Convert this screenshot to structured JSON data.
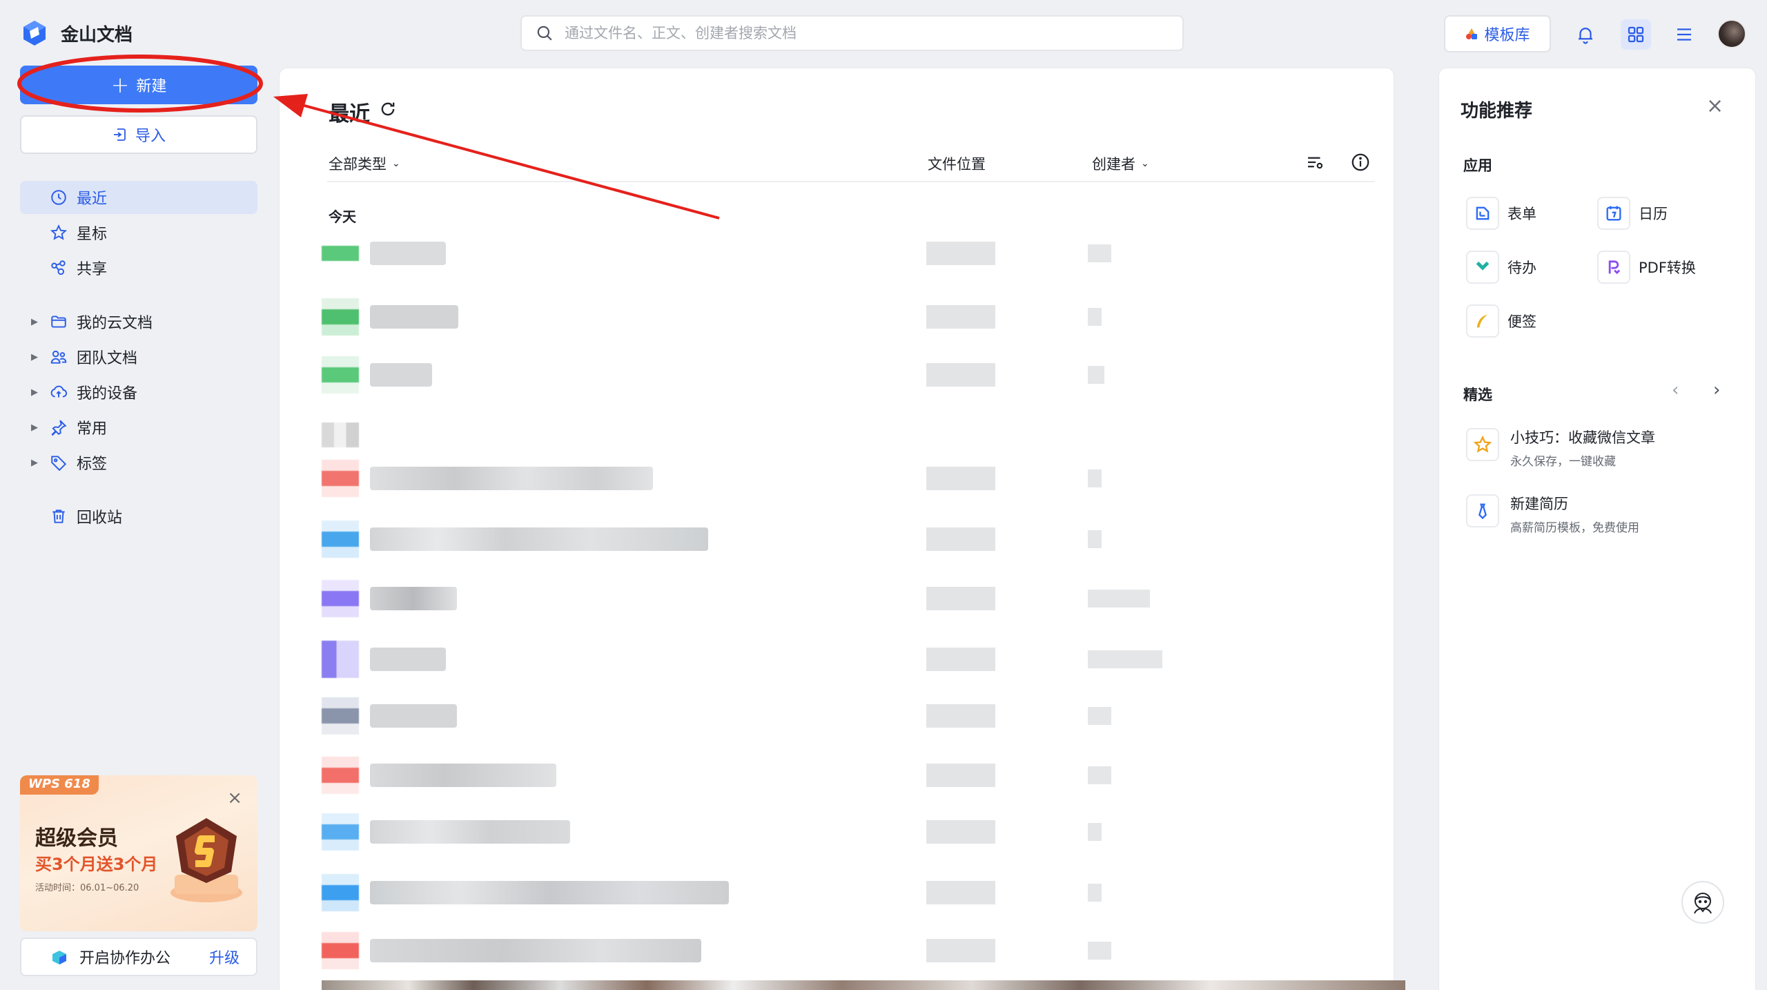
{
  "app": {
    "name": "金山文档"
  },
  "search": {
    "placeholder": "通过文件名、正文、创建者搜索文档"
  },
  "header": {
    "template_label": "模板库"
  },
  "sidebar": {
    "new_label": "新建",
    "import_label": "导入",
    "nav": [
      {
        "label": "最近",
        "icon": "clock-icon",
        "active": true
      },
      {
        "label": "星标",
        "icon": "star-icon"
      },
      {
        "label": "共享",
        "icon": "share-icon"
      }
    ],
    "folders": [
      {
        "label": "我的云文档",
        "icon": "folder-icon"
      },
      {
        "label": "团队文档",
        "icon": "team-icon"
      },
      {
        "label": "我的设备",
        "icon": "cloud-device-icon"
      },
      {
        "label": "常用",
        "icon": "pin-icon"
      },
      {
        "label": "标签",
        "icon": "tag-icon"
      }
    ],
    "trash_label": "回收站",
    "promo": {
      "tag": "WPS 618",
      "title": "超级会员",
      "subtitle": "买3个月送3个月",
      "period": "活动时间：06.01~06.20"
    },
    "collab": {
      "label": "开启协作办公",
      "upgrade": "升级"
    }
  },
  "main": {
    "title": "最近",
    "columns": {
      "type_filter": "全部类型",
      "location": "文件位置",
      "creator": "创建者"
    },
    "group_today": "今天"
  },
  "right_panel": {
    "title": "功能推荐",
    "apps_heading": "应用",
    "apps": [
      {
        "label": "表单",
        "icon": "form-icon",
        "color": "#2b6af3"
      },
      {
        "label": "日历",
        "icon": "calendar-icon",
        "color": "#2b6af3"
      },
      {
        "label": "待办",
        "icon": "todo-icon",
        "color": "#22b0a2"
      },
      {
        "label": "PDF转换",
        "icon": "pdf-convert-icon",
        "color": "#8a4cf0"
      },
      {
        "label": "便签",
        "icon": "note-icon",
        "color": "#e8b21c"
      }
    ],
    "featured_heading": "精选",
    "featured": [
      {
        "title": "小技巧：收藏微信文章",
        "subtitle": "永久保存，一键收藏",
        "icon": "star-outline-icon",
        "color": "#f0a319"
      },
      {
        "title": "新建简历",
        "subtitle": "高薪简历模板，免费使用",
        "icon": "tie-icon",
        "color": "#2b6af3"
      }
    ]
  },
  "colors": {
    "accent": "#3e7af7",
    "annotation": "#e5211c"
  }
}
